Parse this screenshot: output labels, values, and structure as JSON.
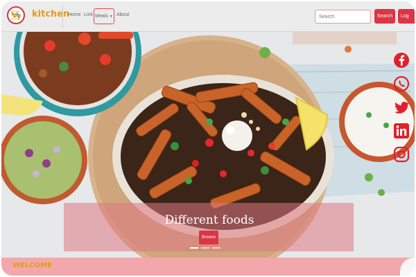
{
  "navbar": {
    "brand": "kitchen",
    "links": {
      "home": "Home",
      "link": "Link",
      "meals": "Meals",
      "about": "About"
    },
    "search_placeholder": "Search",
    "search_button": "Search",
    "login_button": "Log"
  },
  "hero": {
    "caption_title": "Different foods",
    "browse_button": "Browse",
    "slides": 3,
    "active_slide": 1
  },
  "social": {
    "icons": [
      "facebook-icon",
      "whatsapp-icon",
      "twitter-icon",
      "linkedin-icon",
      "instagram-icon"
    ],
    "color": "#e0212b"
  },
  "welcome": {
    "heading": "WELCOME"
  },
  "colors": {
    "accent": "#dc3545",
    "brand": "#e39c1a",
    "welcome_band": "#f2a8ab"
  }
}
